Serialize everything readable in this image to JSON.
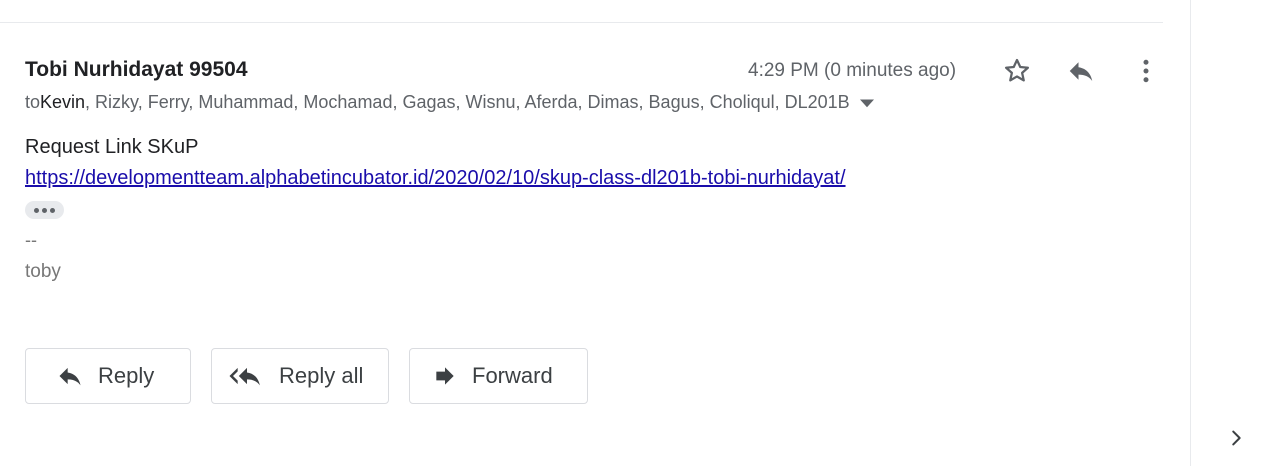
{
  "message": {
    "sender": "Tobi Nurhidayat 99504",
    "time": "4:29 PM (0 minutes ago)",
    "recipients": {
      "prefix": "to ",
      "first": "Kevin",
      "rest": ", Rizky, Ferry, Muhammad, Mochamad, Gagas, Wisnu, Aferda, Dimas, Bagus, Choliqul, DL201B"
    },
    "body": {
      "line1": "Request Link SKuP",
      "link": "https://developmentteam.alphabetincubator.id/2020/02/10/skup-class-dl201b-tobi-nurhidayat/"
    },
    "signature": {
      "dash": "--",
      "name": "toby"
    }
  },
  "header_icons": [
    "star-icon",
    "reply-icon",
    "more-vert-icon",
    "chevron-down-icon"
  ],
  "actions": {
    "reply": "Reply",
    "reply_all": "Reply all",
    "forward": "Forward"
  },
  "colors": {
    "link": "#1a0dab",
    "icon": "#5f6368",
    "border": "#dadce0"
  }
}
